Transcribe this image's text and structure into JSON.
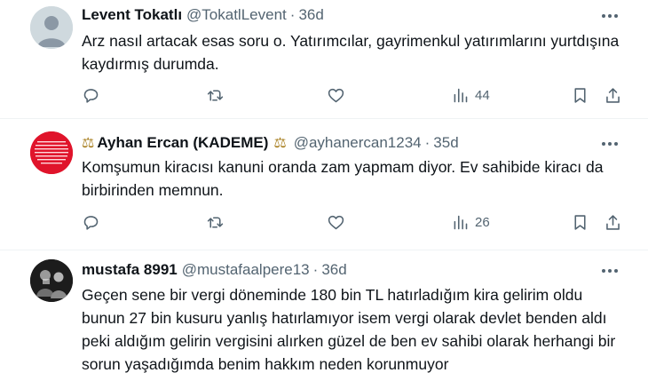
{
  "tweets": [
    {
      "author_name": "Levent Tokatlı",
      "author_handle": "@TokatlLevent",
      "separator": "·",
      "time": "36d",
      "text": "Arz nasıl artacak esas soru o. Yatırımcılar, gayrimenkul yatırımlarını yurtdışına kaydırmış durumda.",
      "views": "44",
      "avatar_icon": "default-avatar-icon"
    },
    {
      "author_name": "Ayhan Ercan (KADEME)",
      "author_handle": "@ayhanercan1234",
      "separator": "·",
      "time": "35d",
      "text": "Komşumun kiracısı kanuni oranda zam yapmam diyor.  Ev sahibide kiracı da birbirinden memnun.",
      "views": "26",
      "name_emoji": "⚖",
      "avatar_icon": "red-circle-avatar"
    },
    {
      "author_name": "mustafa 8991",
      "author_handle": "@mustafaalpere13",
      "separator": "·",
      "time": "36d",
      "text": "Geçen sene bir vergi döneminde 180 bin TL hatırladığım kira gelirim oldu bunun 27 bin kusuru yanlış hatırlamıyor isem vergi olarak devlet benden aldı peki aldığım gelirin vergisini alırken güzel de ben ev sahibi olarak herhangi bir sorun yaşadığımda benim hakkım neden korunmuyor",
      "avatar_icon": "dark-photo-avatar"
    }
  ],
  "colors": {
    "text_primary": "#0f1419",
    "text_secondary": "#536471",
    "divider": "#eff3f4",
    "avatar_red": "#e0142b"
  }
}
